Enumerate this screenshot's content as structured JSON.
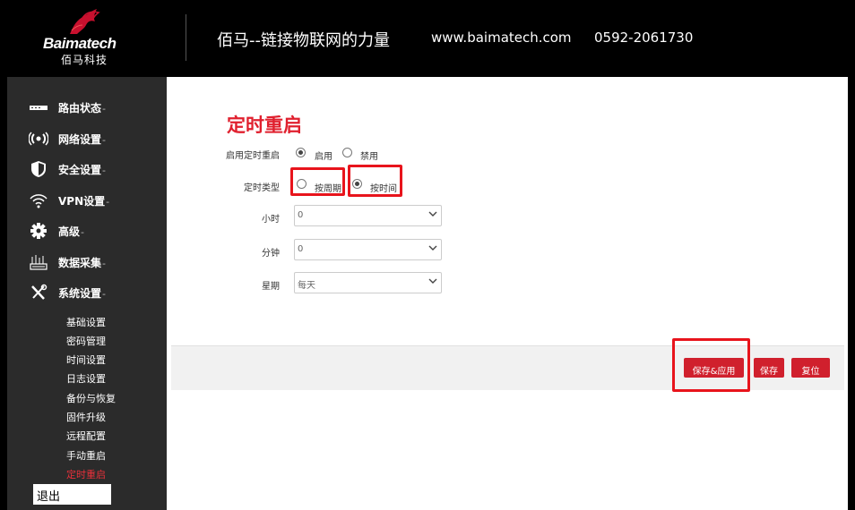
{
  "header": {
    "brand_name": "Baimatech",
    "brand_cn": "佰马科技",
    "slogan": "佰马--链接物联网的力量",
    "website": "www.baimatech.com",
    "phone": "0592-2061730"
  },
  "sidebar": {
    "menu": [
      {
        "label": "路由状态",
        "icon": "router-status-icon"
      },
      {
        "label": "网络设置",
        "icon": "wireless-signal-icon"
      },
      {
        "label": "安全设置",
        "icon": "shield-icon"
      },
      {
        "label": "VPN设置",
        "icon": "vpn-wifi-icon"
      },
      {
        "label": "高级",
        "icon": "gear-icon"
      },
      {
        "label": "数据采集",
        "icon": "data-collection-icon"
      },
      {
        "label": "系统设置",
        "icon": "tools-icon"
      }
    ],
    "caret": "-",
    "submenu": [
      "基础设置",
      "密码管理",
      "时间设置",
      "日志设置",
      "备份与恢复",
      "固件升级",
      "远程配置",
      "手动重启",
      "定时重启"
    ],
    "active_submenu": "定时重启",
    "logout": "退出"
  },
  "main": {
    "title": "定时重启",
    "enable": {
      "label": "启用定时重启",
      "options": [
        "启用",
        "禁用"
      ],
      "selected": "启用"
    },
    "type": {
      "label": "定时类型",
      "options": [
        "按周期",
        "按时间"
      ],
      "selected": "按时间"
    },
    "hour": {
      "label": "小时",
      "value": "0"
    },
    "minute": {
      "label": "分钟",
      "value": "0"
    },
    "week": {
      "label": "星期",
      "value": "每天"
    },
    "buttons": {
      "save_apply": "保存&应用",
      "save": "保存",
      "reset": "复位"
    }
  },
  "colors": {
    "accent": "#d0202d",
    "highlight_box": "#e8141c",
    "sidebar_bg": "#2b2b2b"
  }
}
